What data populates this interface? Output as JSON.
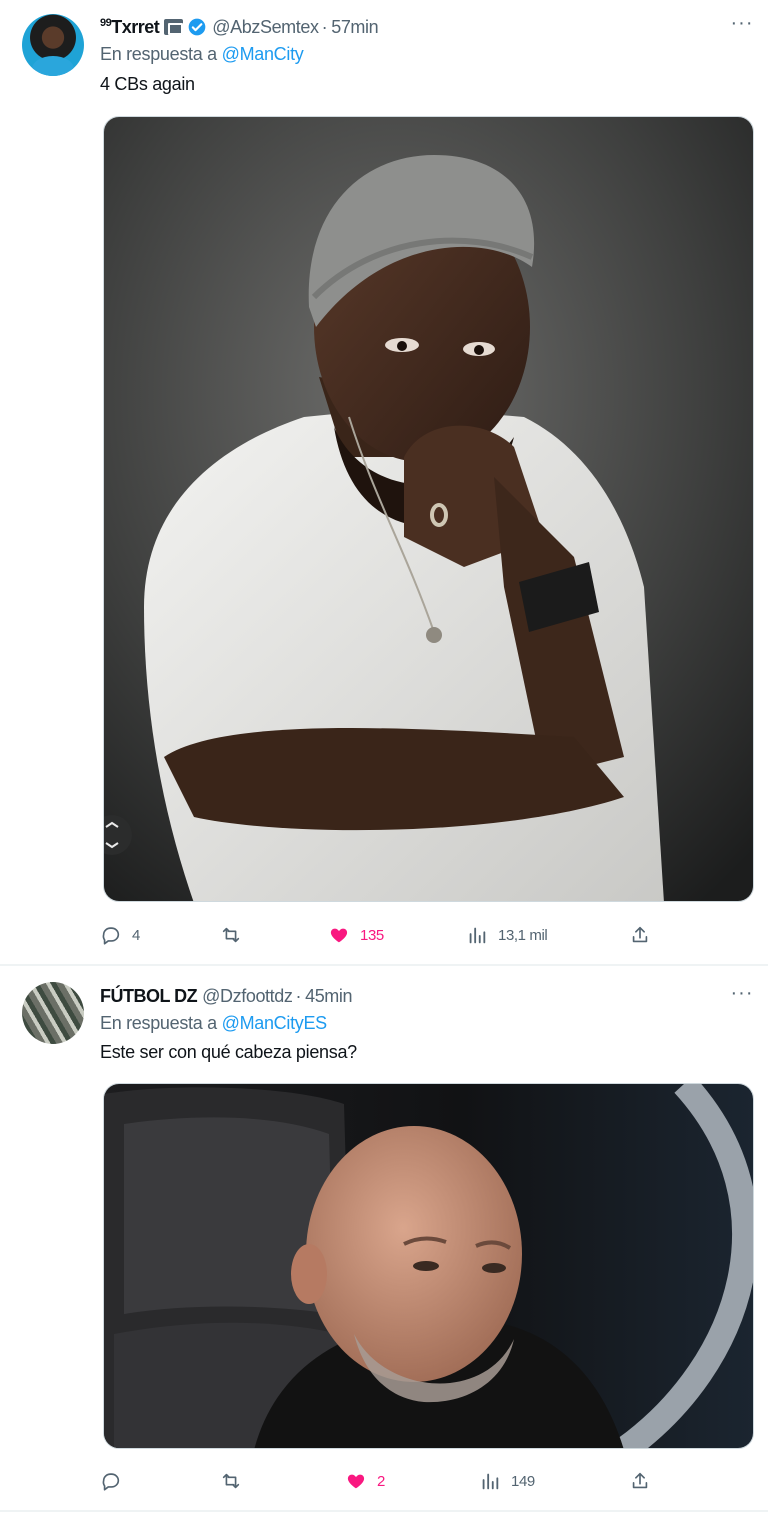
{
  "tweets": [
    {
      "display_name": "Txrret",
      "display_prefix": "99",
      "handle": "@AbzSemtex",
      "separator": "·",
      "time": "57min",
      "reply_prefix": "En respuesta a",
      "reply_to": "@ManCity",
      "text": "4 CBs again",
      "stats": {
        "replies": "4",
        "likes": "135",
        "views": "13,1 mil"
      },
      "liked": true
    },
    {
      "display_name": "FÚTBOL DZ",
      "display_prefix": "",
      "handle": "@Dzfoottdz",
      "separator": "·",
      "time": "45min",
      "reply_prefix": "En respuesta a",
      "reply_to": "@ManCityES",
      "text": "Este ser con qué cabeza piensa?",
      "stats": {
        "replies": "",
        "reposts": "",
        "likes": "2",
        "views": "149"
      },
      "liked": true
    }
  ],
  "icons": {
    "reply": "reply-icon",
    "repost": "repost-icon",
    "like": "heart-icon",
    "views": "views-icon",
    "share": "share-icon",
    "more": "more-icon",
    "verified": "verified-icon"
  },
  "colors": {
    "accent": "#1d9bf0",
    "like": "#f91880",
    "muted": "#536471",
    "text": "#0f1419"
  }
}
